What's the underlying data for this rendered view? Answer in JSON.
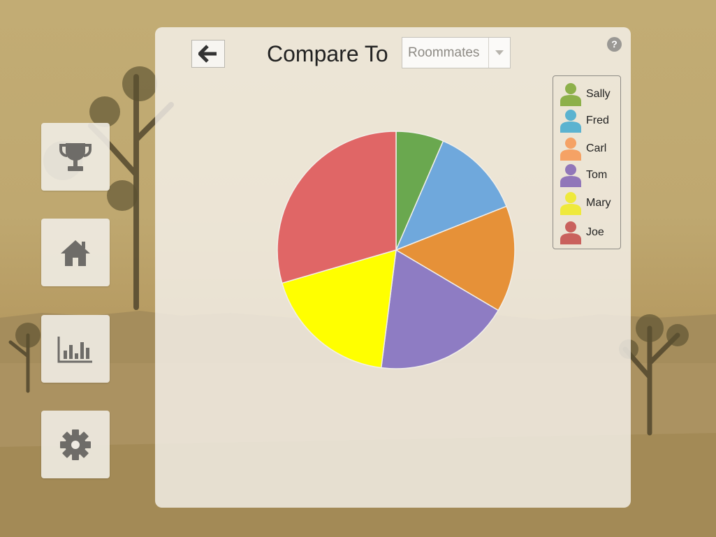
{
  "nav": {
    "items": [
      {
        "name": "trophy-icon",
        "icon": "trophy"
      },
      {
        "name": "home-icon",
        "icon": "home"
      },
      {
        "name": "bar-chart-icon",
        "icon": "bar-chart"
      },
      {
        "name": "gear-icon",
        "icon": "gear"
      }
    ],
    "icon_color": "#6e6c68"
  },
  "header": {
    "back_icon": "arrow-left-icon",
    "title": "Compare To",
    "select": {
      "value": "Roommates"
    },
    "help_label": "?"
  },
  "legend": [
    {
      "name": "Sally",
      "color": "#8db04a"
    },
    {
      "name": "Fred",
      "color": "#5bb3d0"
    },
    {
      "name": "Carl",
      "color": "#f5a265"
    },
    {
      "name": "Tom",
      "color": "#9177b9"
    },
    {
      "name": "Mary",
      "color": "#efe93c"
    },
    {
      "name": "Joe",
      "color": "#c9615d"
    }
  ],
  "chart_data": {
    "type": "pie",
    "title": "",
    "slices": [
      {
        "label": "Sally",
        "value": 6.5,
        "color": "#6aa84f"
      },
      {
        "label": "Fred",
        "value": 12.5,
        "color": "#6fa8dc"
      },
      {
        "label": "Carl",
        "value": 14.5,
        "color": "#e69138"
      },
      {
        "label": "Tom",
        "value": 18.5,
        "color": "#8e7cc3"
      },
      {
        "label": "Mary",
        "value": 18.5,
        "color": "#ffff00"
      },
      {
        "label": "Joe",
        "value": 29.5,
        "color": "#e06666"
      }
    ]
  }
}
